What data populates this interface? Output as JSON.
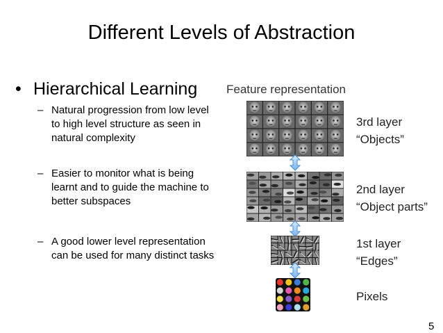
{
  "slide": {
    "title": "Different Levels of Abstraction",
    "bullet": "Hierarchical Learning",
    "bullet_marker": "•",
    "dash": "–",
    "subpoints": [
      "Natural progression from low level to high level structure as seen in natural complexity",
      "Easier to monitor what is being learnt and to guide the machine to better subspaces",
      "A good lower level representation can be used for many distinct tasks"
    ],
    "page_number": "5"
  },
  "figure": {
    "heading": "Feature representation",
    "layers": [
      {
        "name": "3rd layer",
        "description": "“Objects”"
      },
      {
        "name": "2nd layer",
        "description": "“Object parts”"
      },
      {
        "name": "1st layer",
        "description": "“Edges”"
      },
      {
        "name": "Pixels",
        "description": ""
      }
    ],
    "pixel_colors": [
      "#e8362a",
      "#f2c21b",
      "#3b7bd8",
      "#4fb34a",
      "#d8d8d8",
      "#e35bb0",
      "#f28a1e",
      "#2aa8d8",
      "#f5e04a",
      "#8a5bc8",
      "#d83a3a",
      "#6cc24a",
      "#f2a0c0",
      "#3a3ad8",
      "#b0e0f0",
      "#e0a030"
    ],
    "arrow_color": "#4a90d9"
  }
}
